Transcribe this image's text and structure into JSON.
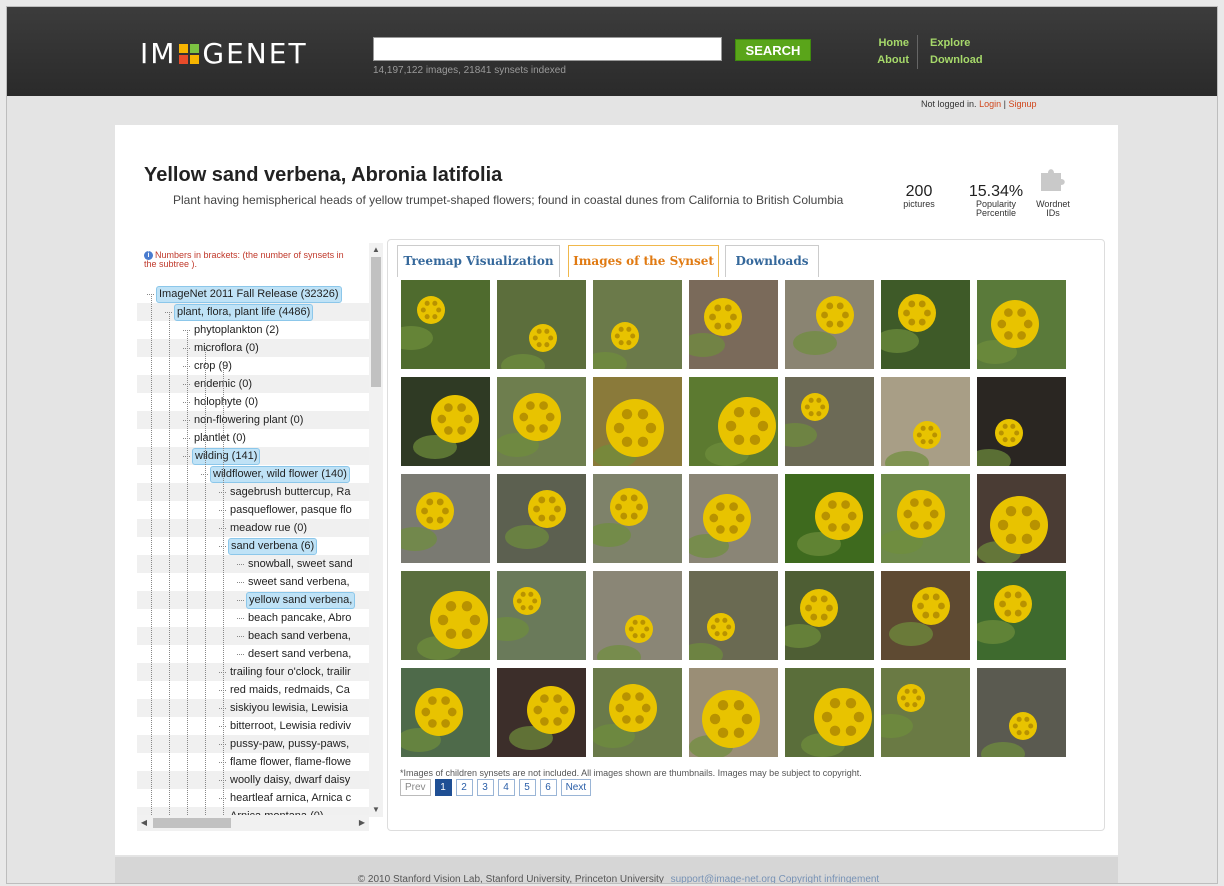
{
  "header": {
    "logo_left": "IM",
    "logo_right": "GENET",
    "search_placeholder": "",
    "search_button": "SEARCH",
    "indexed_text": "14,197,122 images, 21841 synsets indexed",
    "nav": {
      "home": "Home",
      "about": "About",
      "explore": "Explore",
      "download": "Download"
    }
  },
  "login": {
    "status": "Not logged in.",
    "login": "Login",
    "sep": "|",
    "signup": "Signup"
  },
  "synset": {
    "title": "Yellow sand verbena, Abronia latifolia",
    "description": "Plant having hemispherical heads of yellow trumpet-shaped flowers; found in coastal dunes from California to British Columbia",
    "pictures_count": "200",
    "pictures_label": "pictures",
    "popularity_value": "15.34%",
    "popularity_label": "Popularity Percentile",
    "wordnet_label": "Wordnet IDs"
  },
  "tree": {
    "note": "Numbers in brackets: (the number of synsets in the subtree ).",
    "rows": [
      {
        "label": "ImageNet 2011 Fall Release (32326)",
        "depth": 0,
        "selected": true
      },
      {
        "label": "plant, flora, plant life (4486)",
        "depth": 1,
        "selected": true
      },
      {
        "label": "phytoplankton (2)",
        "depth": 2,
        "selected": false
      },
      {
        "label": "microflora (0)",
        "depth": 2,
        "selected": false
      },
      {
        "label": "crop (9)",
        "depth": 2,
        "selected": false
      },
      {
        "label": "endemic (0)",
        "depth": 2,
        "selected": false
      },
      {
        "label": "holophyte (0)",
        "depth": 2,
        "selected": false
      },
      {
        "label": "non-flowering plant (0)",
        "depth": 2,
        "selected": false
      },
      {
        "label": "plantlet (0)",
        "depth": 2,
        "selected": false
      },
      {
        "label": "wilding (141)",
        "depth": 2,
        "selected": true
      },
      {
        "label": "wildflower, wild flower (140)",
        "depth": 3,
        "selected": true
      },
      {
        "label": "sagebrush buttercup, Ra",
        "depth": 4,
        "selected": false
      },
      {
        "label": "pasqueflower, pasque flo",
        "depth": 4,
        "selected": false
      },
      {
        "label": "meadow rue (0)",
        "depth": 4,
        "selected": false
      },
      {
        "label": "sand verbena (6)",
        "depth": 4,
        "selected": true
      },
      {
        "label": "snowball, sweet sand",
        "depth": 5,
        "selected": false
      },
      {
        "label": "sweet sand verbena,",
        "depth": 5,
        "selected": false
      },
      {
        "label": "yellow sand verbena,",
        "depth": 5,
        "selected": true
      },
      {
        "label": "beach pancake, Abro",
        "depth": 5,
        "selected": false
      },
      {
        "label": "beach sand verbena,",
        "depth": 5,
        "selected": false
      },
      {
        "label": "desert sand verbena,",
        "depth": 5,
        "selected": false
      },
      {
        "label": "trailing four o'clock, trailir",
        "depth": 4,
        "selected": false
      },
      {
        "label": "red maids, redmaids, Ca",
        "depth": 4,
        "selected": false
      },
      {
        "label": "siskiyou lewisia, Lewisia",
        "depth": 4,
        "selected": false
      },
      {
        "label": "bitterroot, Lewisia rediviv",
        "depth": 4,
        "selected": false
      },
      {
        "label": "pussy-paw, pussy-paws,",
        "depth": 4,
        "selected": false
      },
      {
        "label": "flame flower, flame-flowe",
        "depth": 4,
        "selected": false
      },
      {
        "label": "woolly daisy, dwarf daisy",
        "depth": 4,
        "selected": false
      },
      {
        "label": "heartleaf arnica, Arnica c",
        "depth": 4,
        "selected": false
      },
      {
        "label": "Arnica montana (0)",
        "depth": 4,
        "selected": false
      }
    ]
  },
  "tabs": [
    {
      "label": "Treemap Visualization"
    },
    {
      "label": "Images of the Synset"
    },
    {
      "label": "Downloads"
    }
  ],
  "gallery": {
    "note": "*Images of children synsets are not included. All images shown are thumbnails. Images may be subject to copyright.",
    "pager": [
      "Prev",
      "1",
      "2",
      "3",
      "4",
      "5",
      "6",
      "Next"
    ]
  },
  "footer": {
    "copyright": "© 2010 Stanford Vision Lab, Stanford University, Princeton University",
    "email": "support@image-net.org",
    "copyright_link": "Copyright infringement"
  },
  "colors": {
    "header_bg": "#333333",
    "search_btn": "#5aa51a",
    "nav_link": "#a6d96a",
    "tab_active": "#e07a12",
    "tab_inactive": "#35689b",
    "selected_node": "#bfe2f6",
    "pager_current": "#1f4f94"
  }
}
